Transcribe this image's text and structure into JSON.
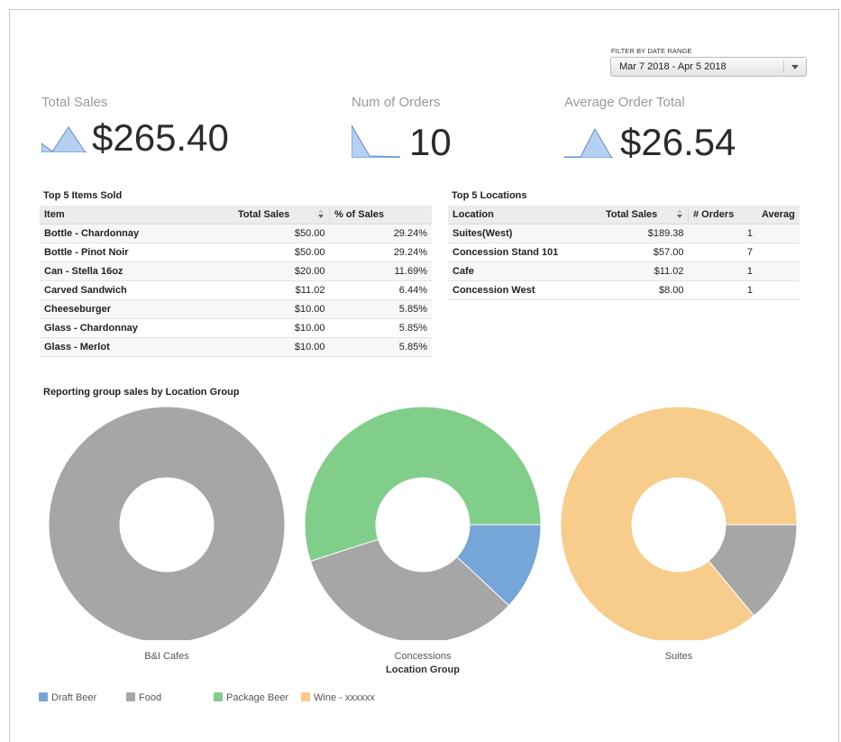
{
  "filter": {
    "label": "FILTER BY DATE RANGE",
    "selected": "Mar 7 2018 - Apr 5 2018"
  },
  "kpis": {
    "total_sales": {
      "label": "Total Sales",
      "value": "$265.40"
    },
    "num_orders": {
      "label": "Num of Orders",
      "value": "10"
    },
    "avg_order": {
      "label": "Average Order Total",
      "value": "$26.54"
    }
  },
  "top_items": {
    "title": "Top 5 Items Sold",
    "columns": [
      "Item",
      "Total Sales",
      "% of Sales"
    ],
    "rows": [
      [
        "Bottle - Chardonnay",
        "$50.00",
        "29.24%"
      ],
      [
        "Bottle - Pinot Noir",
        "$50.00",
        "29.24%"
      ],
      [
        "Can - Stella 16oz",
        "$20.00",
        "11.69%"
      ],
      [
        "Carved Sandwich",
        "$11.02",
        "6.44%"
      ],
      [
        "Cheeseburger",
        "$10.00",
        "5.85%"
      ],
      [
        "Glass - Chardonnay",
        "$10.00",
        "5.85%"
      ],
      [
        "Glass - Merlot",
        "$10.00",
        "5.85%"
      ]
    ]
  },
  "top_locations": {
    "title": "Top 5 Locations",
    "columns": [
      "Location",
      "Total Sales",
      "# Orders",
      "Averag"
    ],
    "rows": [
      [
        "Suites(West)",
        "$189.38",
        "1",
        ""
      ],
      [
        "Concession Stand 101",
        "$57.00",
        "7",
        ""
      ],
      [
        "Cafe",
        "$11.02",
        "1",
        ""
      ],
      [
        "Concession West",
        "$8.00",
        "1",
        ""
      ]
    ]
  },
  "chart_data": {
    "type": "pie",
    "title": "Reporting group sales by Location Group",
    "xlabel": "Location Group",
    "donut": true,
    "categories": [
      "B&I Cafes",
      "Concessions",
      "Suites"
    ],
    "series": [
      {
        "name": "Draft Beer",
        "color": "#76a5d8",
        "values": [
          0,
          0.12,
          0
        ]
      },
      {
        "name": "Food",
        "color": "#a6a6a6",
        "values": [
          1,
          0.33,
          0.14
        ]
      },
      {
        "name": "Package Beer",
        "color": "#81ce8a",
        "values": [
          0,
          0.55,
          0
        ]
      },
      {
        "name": "Wine - xxxxxx",
        "color": "#f8cd8c",
        "values": [
          0,
          0,
          0.86
        ]
      }
    ],
    "legend_position": "bottom-left"
  }
}
